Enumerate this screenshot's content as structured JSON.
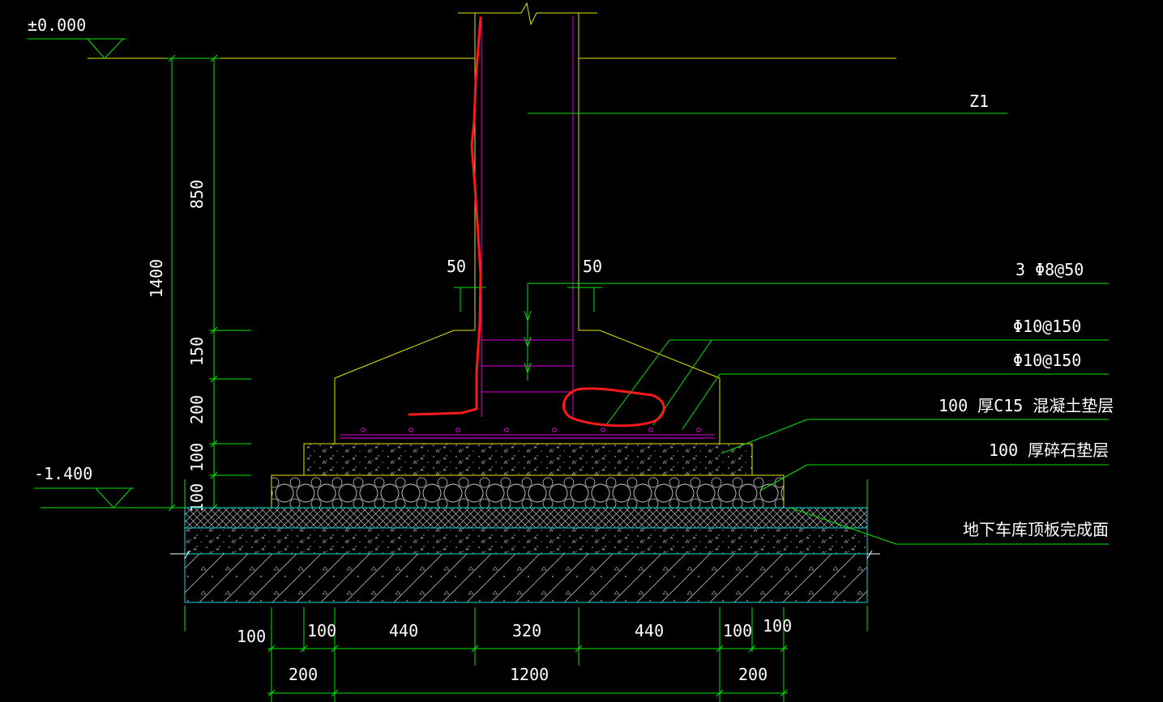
{
  "colors": {
    "background": "#000000",
    "outline": "#e6e600",
    "dimension": "#00e600",
    "rebar": "#e600e6",
    "ground": "#00dddd",
    "markup": "#ff1a1a",
    "text": "#ffffff"
  },
  "elevations": {
    "top": "±0.000",
    "bottom": "-1.400"
  },
  "vertical_dims": {
    "total": "1400",
    "upper": "850",
    "seg_150": "150",
    "seg_200": "200",
    "seg_100a": "100",
    "seg_100b": "100"
  },
  "column_dims": {
    "left_50": "50",
    "right_50": "50"
  },
  "labels": {
    "column": "Z1",
    "rebar_column": "3 Φ8@50",
    "rebar_base_1": "Φ10@150",
    "rebar_base_2": "Φ10@150",
    "layer_c15": "100  厚C15 混凝土垫层",
    "layer_gravel": "100  厚碎石垫层",
    "garage_roof": "地下车库顶板完成面"
  },
  "horizontal_dims_row1": [
    "100",
    "100",
    "440",
    "320",
    "440",
    "100",
    "100"
  ],
  "horizontal_dims_row2": [
    "200",
    "1200",
    "200"
  ]
}
